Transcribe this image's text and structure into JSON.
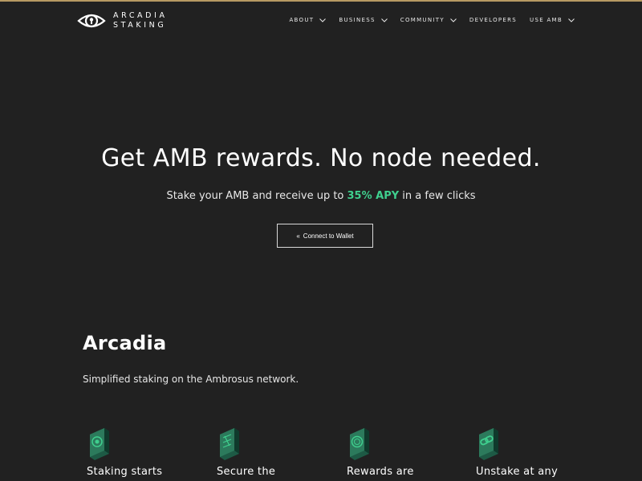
{
  "brand": {
    "line1": "ARCADIA",
    "line2": "STAKING",
    "logo_icon": "eye-lock-icon",
    "top_accent": "#b79a63"
  },
  "nav": {
    "items": [
      {
        "label": "ABOUT",
        "dropdown": true
      },
      {
        "label": "BUSINESS",
        "dropdown": true
      },
      {
        "label": "COMMUNITY",
        "dropdown": true
      },
      {
        "label": "DEVELOPERS",
        "dropdown": false
      },
      {
        "label": "USE AMB",
        "dropdown": true
      }
    ]
  },
  "hero": {
    "title": "Get AMB rewards. No node needed.",
    "subtitle_before": "Stake your AMB and receive up to ",
    "subtitle_highlight": "35% APY",
    "subtitle_after": " in a few clicks",
    "connect_label": "Connect to Wallet",
    "connect_icon": "«",
    "highlight_color": "#3fcf8e"
  },
  "section": {
    "title": "Arcadia",
    "description": "Simplified staking on the Ambrosus network.",
    "features": [
      {
        "label": "Staking starts",
        "icon": "coin-cube-icon"
      },
      {
        "label": "Secure the",
        "icon": "network-cube-icon"
      },
      {
        "label": "Rewards are",
        "icon": "reward-coin-cube-icon"
      },
      {
        "label": "Unstake at any",
        "icon": "link-cube-icon"
      }
    ]
  },
  "colors": {
    "background": "#212121",
    "text": "#ffffff",
    "icon_green": "#3fcf8e",
    "icon_dark": "#1d5a45"
  }
}
